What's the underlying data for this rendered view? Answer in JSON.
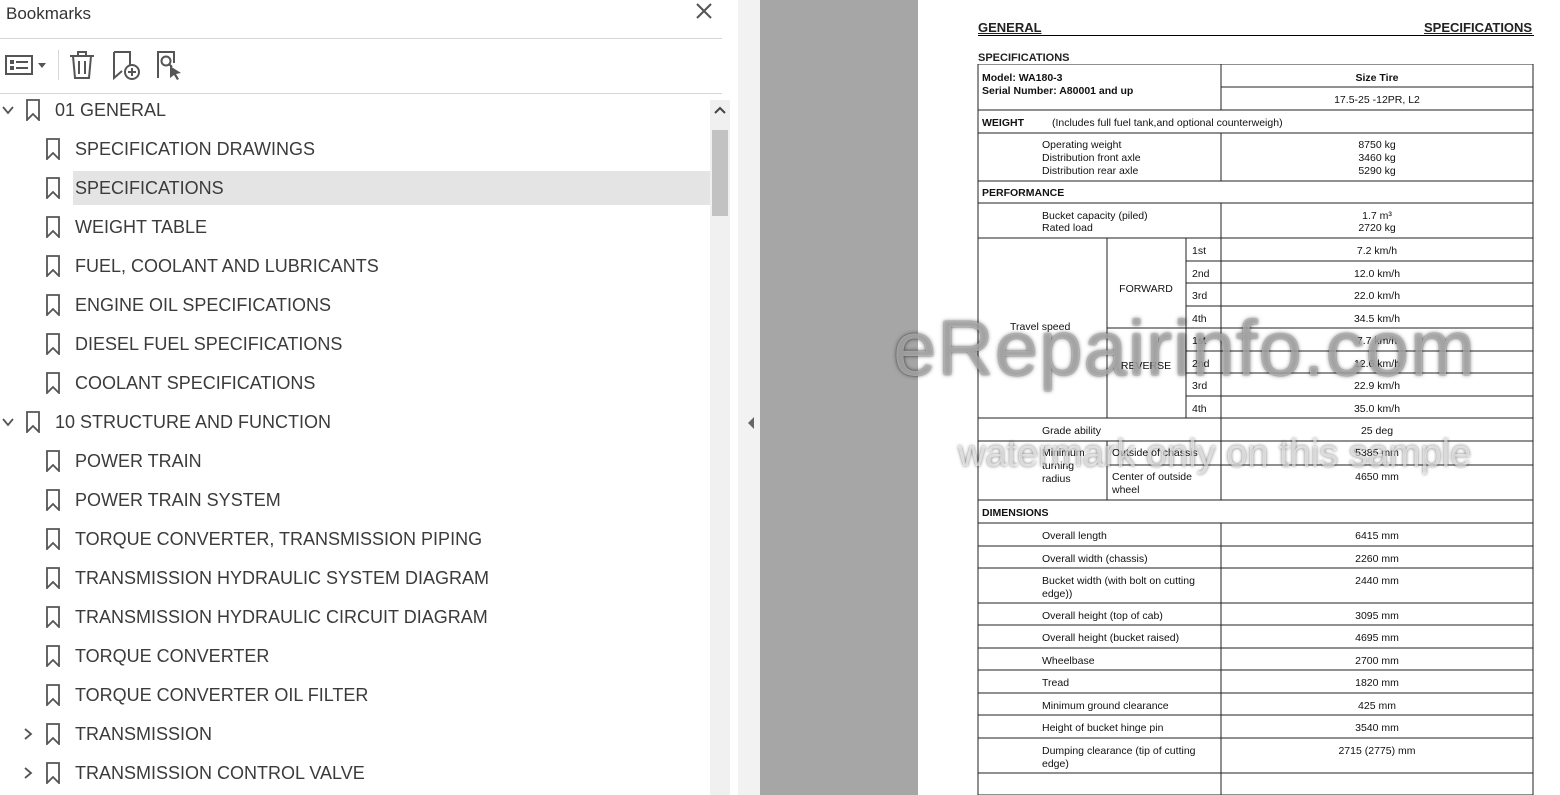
{
  "panel": {
    "title": "Bookmarks",
    "close_label": "✕"
  },
  "bookmarks": [
    {
      "label": "01 GENERAL",
      "level": 0,
      "chevron": "down"
    },
    {
      "label": "SPECIFICATION DRAWINGS",
      "level": 1
    },
    {
      "label": "SPECIFICATIONS",
      "level": 1,
      "selected": true
    },
    {
      "label": "WEIGHT TABLE",
      "level": 1
    },
    {
      "label": "FUEL, COOLANT AND LUBRICANTS",
      "level": 1
    },
    {
      "label": "ENGINE OIL SPECIFICATIONS",
      "level": 1
    },
    {
      "label": "DIESEL FUEL SPECIFICATIONS",
      "level": 1
    },
    {
      "label": "COOLANT SPECIFICATIONS",
      "level": 1
    },
    {
      "label": "10 STRUCTURE AND FUNCTION",
      "level": 0,
      "chevron": "down"
    },
    {
      "label": "POWER TRAIN",
      "level": 1
    },
    {
      "label": "POWER TRAIN SYSTEM",
      "level": 1
    },
    {
      "label": "TORQUE CONVERTER, TRANSMISSION PIPING",
      "level": 1
    },
    {
      "label": "TRANSMISSION HYDRAULIC SYSTEM DIAGRAM",
      "level": 1
    },
    {
      "label": "TRANSMISSION HYDRAULIC CIRCUIT DIAGRAM",
      "level": 1
    },
    {
      "label": "TORQUE CONVERTER",
      "level": 1
    },
    {
      "label": "TORQUE CONVERTER OIL FILTER",
      "level": 1
    },
    {
      "label": "TRANSMISSION",
      "level": 1,
      "chevron": "right"
    },
    {
      "label": "TRANSMISSION CONTROL VALVE",
      "level": 1,
      "chevron": "right"
    }
  ],
  "document": {
    "header_left": "GENERAL",
    "header_right": "SPECIFICATIONS",
    "section_title": "SPECIFICATIONS",
    "model": "Model: WA180-3",
    "serial": "Serial Number: A80001 and up",
    "size_tire_label": "Size Tire",
    "size_tire_value": "17.5-25 -12PR, L2",
    "weight_label": "WEIGHT",
    "weight_note": "(Includes full fuel tank,and optional counterweigh)",
    "operating_weight": "Operating weight",
    "dist_front": "Distribution front axle",
    "dist_rear": "Distribution rear axle",
    "operating_weight_val": "8750 kg",
    "dist_front_val": "3460 kg",
    "dist_rear_val": "5290 kg",
    "performance_label": "PERFORMANCE",
    "bucket_capacity": "Bucket capacity (piled)",
    "rated_load": "Rated load",
    "bucket_capacity_val": "1.7 m³",
    "rated_load_val": "2720 kg",
    "travel_speed": "Travel speed",
    "forward": "FORWARD",
    "reverse": "REVERSE",
    "gears": [
      "1st",
      "2nd",
      "3rd",
      "4th",
      "1st",
      "2nd",
      "3rd",
      "4th"
    ],
    "speeds": [
      "7.2 km/h",
      "12.0 km/h",
      "22.0 km/h",
      "34.5 km/h",
      "7.7 km/h",
      "12.6 km/h",
      "22.9 km/h",
      "35.0 km/h"
    ],
    "grade_ability": "Grade ability",
    "grade_ability_val": "25 deg",
    "min_turning_1": "Minimum",
    "min_turning_2": "turning",
    "min_turning_3": "radius",
    "outside_chassis": "Outside of chassis",
    "outside_chassis_val": "5385 mm",
    "center_outside_1": "Center of outside",
    "center_outside_2": "wheel",
    "center_outside_val": "4650 mm",
    "dimensions_label": "DIMENSIONS",
    "dimensions": [
      {
        "label": [
          "Overall length"
        ],
        "value": "6415 mm"
      },
      {
        "label": [
          "Overall width (chassis)"
        ],
        "value": "2260 mm"
      },
      {
        "label": [
          "Bucket width (with bolt on cutting",
          "edge))"
        ],
        "value": "2440 mm"
      },
      {
        "label": [
          "Overall height (top of cab)"
        ],
        "value": "3095 mm"
      },
      {
        "label": [
          "Overall height (bucket raised)"
        ],
        "value": "4695 mm"
      },
      {
        "label": [
          "Wheelbase"
        ],
        "value": "2700 mm"
      },
      {
        "label": [
          "Tread"
        ],
        "value": "1820 mm"
      },
      {
        "label": [
          "Minimum ground clearance"
        ],
        "value": "425 mm"
      },
      {
        "label": [
          "Height of bucket hinge pin"
        ],
        "value": "3540 mm"
      },
      {
        "label": [
          "Dumping clearance (tip of cutting",
          "edge)"
        ],
        "value": "2715 (2775) mm"
      }
    ]
  },
  "watermark": {
    "line1": "eRepairinfo.com",
    "line2": "watermark only on this sample"
  }
}
